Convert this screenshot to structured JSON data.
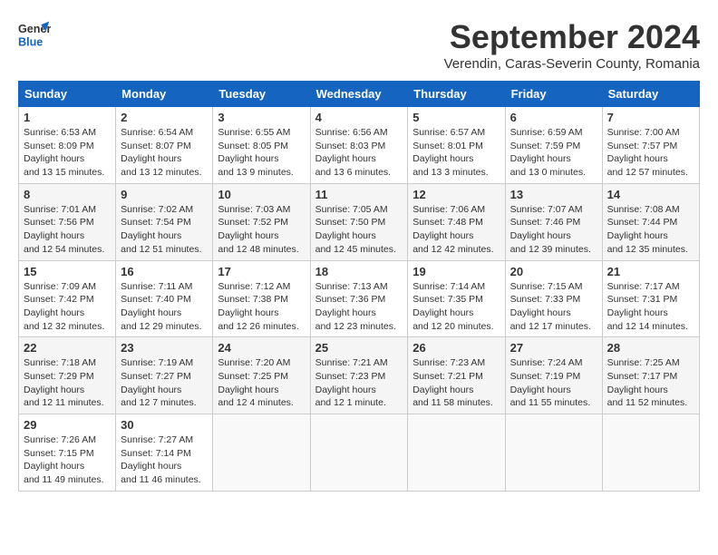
{
  "header": {
    "logo_line1": "General",
    "logo_line2": "Blue",
    "month": "September 2024",
    "location": "Verendin, Caras-Severin County, Romania"
  },
  "weekdays": [
    "Sunday",
    "Monday",
    "Tuesday",
    "Wednesday",
    "Thursday",
    "Friday",
    "Saturday"
  ],
  "weeks": [
    [
      {
        "day": "1",
        "sunrise": "6:53 AM",
        "sunset": "8:09 PM",
        "daylight": "13 hours and 15 minutes."
      },
      {
        "day": "2",
        "sunrise": "6:54 AM",
        "sunset": "8:07 PM",
        "daylight": "13 hours and 12 minutes."
      },
      {
        "day": "3",
        "sunrise": "6:55 AM",
        "sunset": "8:05 PM",
        "daylight": "13 hours and 9 minutes."
      },
      {
        "day": "4",
        "sunrise": "6:56 AM",
        "sunset": "8:03 PM",
        "daylight": "13 hours and 6 minutes."
      },
      {
        "day": "5",
        "sunrise": "6:57 AM",
        "sunset": "8:01 PM",
        "daylight": "13 hours and 3 minutes."
      },
      {
        "day": "6",
        "sunrise": "6:59 AM",
        "sunset": "7:59 PM",
        "daylight": "13 hours and 0 minutes."
      },
      {
        "day": "7",
        "sunrise": "7:00 AM",
        "sunset": "7:57 PM",
        "daylight": "12 hours and 57 minutes."
      }
    ],
    [
      {
        "day": "8",
        "sunrise": "7:01 AM",
        "sunset": "7:56 PM",
        "daylight": "12 hours and 54 minutes."
      },
      {
        "day": "9",
        "sunrise": "7:02 AM",
        "sunset": "7:54 PM",
        "daylight": "12 hours and 51 minutes."
      },
      {
        "day": "10",
        "sunrise": "7:03 AM",
        "sunset": "7:52 PM",
        "daylight": "12 hours and 48 minutes."
      },
      {
        "day": "11",
        "sunrise": "7:05 AM",
        "sunset": "7:50 PM",
        "daylight": "12 hours and 45 minutes."
      },
      {
        "day": "12",
        "sunrise": "7:06 AM",
        "sunset": "7:48 PM",
        "daylight": "12 hours and 42 minutes."
      },
      {
        "day": "13",
        "sunrise": "7:07 AM",
        "sunset": "7:46 PM",
        "daylight": "12 hours and 39 minutes."
      },
      {
        "day": "14",
        "sunrise": "7:08 AM",
        "sunset": "7:44 PM",
        "daylight": "12 hours and 35 minutes."
      }
    ],
    [
      {
        "day": "15",
        "sunrise": "7:09 AM",
        "sunset": "7:42 PM",
        "daylight": "12 hours and 32 minutes."
      },
      {
        "day": "16",
        "sunrise": "7:11 AM",
        "sunset": "7:40 PM",
        "daylight": "12 hours and 29 minutes."
      },
      {
        "day": "17",
        "sunrise": "7:12 AM",
        "sunset": "7:38 PM",
        "daylight": "12 hours and 26 minutes."
      },
      {
        "day": "18",
        "sunrise": "7:13 AM",
        "sunset": "7:36 PM",
        "daylight": "12 hours and 23 minutes."
      },
      {
        "day": "19",
        "sunrise": "7:14 AM",
        "sunset": "7:35 PM",
        "daylight": "12 hours and 20 minutes."
      },
      {
        "day": "20",
        "sunrise": "7:15 AM",
        "sunset": "7:33 PM",
        "daylight": "12 hours and 17 minutes."
      },
      {
        "day": "21",
        "sunrise": "7:17 AM",
        "sunset": "7:31 PM",
        "daylight": "12 hours and 14 minutes."
      }
    ],
    [
      {
        "day": "22",
        "sunrise": "7:18 AM",
        "sunset": "7:29 PM",
        "daylight": "12 hours and 11 minutes."
      },
      {
        "day": "23",
        "sunrise": "7:19 AM",
        "sunset": "7:27 PM",
        "daylight": "12 hours and 7 minutes."
      },
      {
        "day": "24",
        "sunrise": "7:20 AM",
        "sunset": "7:25 PM",
        "daylight": "12 hours and 4 minutes."
      },
      {
        "day": "25",
        "sunrise": "7:21 AM",
        "sunset": "7:23 PM",
        "daylight": "12 hours and 1 minute."
      },
      {
        "day": "26",
        "sunrise": "7:23 AM",
        "sunset": "7:21 PM",
        "daylight": "11 hours and 58 minutes."
      },
      {
        "day": "27",
        "sunrise": "7:24 AM",
        "sunset": "7:19 PM",
        "daylight": "11 hours and 55 minutes."
      },
      {
        "day": "28",
        "sunrise": "7:25 AM",
        "sunset": "7:17 PM",
        "daylight": "11 hours and 52 minutes."
      }
    ],
    [
      {
        "day": "29",
        "sunrise": "7:26 AM",
        "sunset": "7:15 PM",
        "daylight": "11 hours and 49 minutes."
      },
      {
        "day": "30",
        "sunrise": "7:27 AM",
        "sunset": "7:14 PM",
        "daylight": "11 hours and 46 minutes."
      },
      null,
      null,
      null,
      null,
      null
    ]
  ],
  "labels": {
    "sunrise": "Sunrise:",
    "sunset": "Sunset:",
    "daylight": "Daylight hours"
  }
}
